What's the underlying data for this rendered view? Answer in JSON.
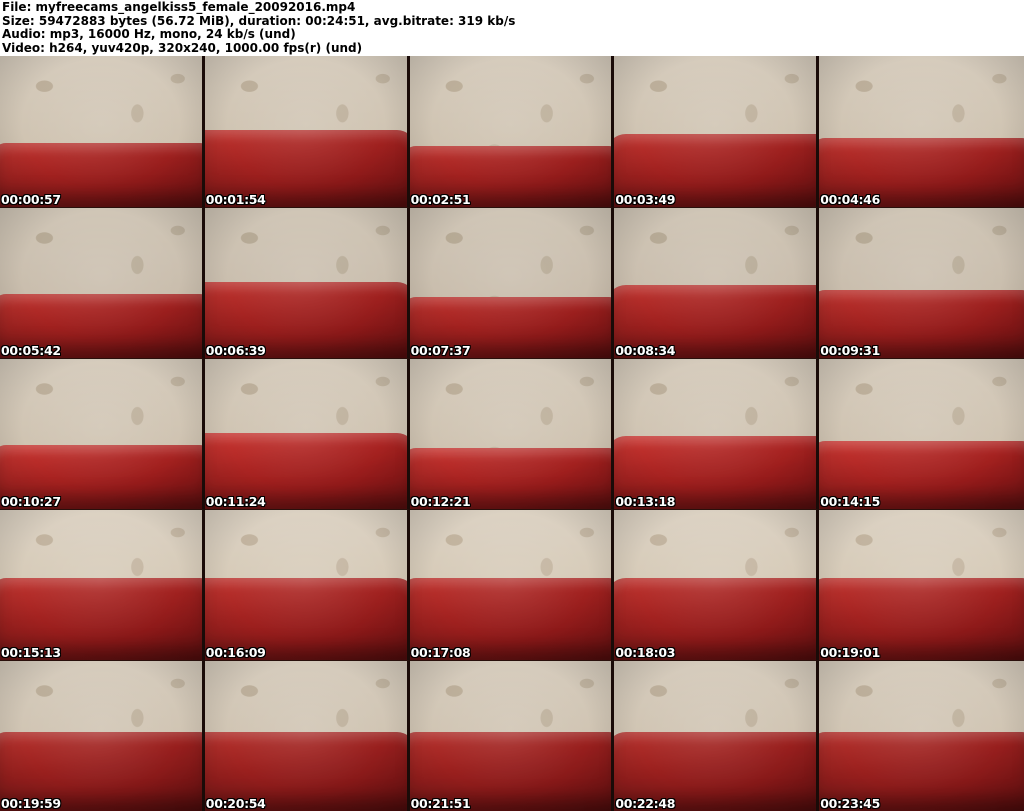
{
  "header": {
    "lines": [
      "File: myfreecams_angelkiss5_female_20092016.mp4",
      "Size: 59472883 bytes (56.72 MiB), duration: 00:24:51, avg.bitrate: 319 kb/s",
      "Audio: mp3, 16000 Hz, mono, 24 kb/s (und)",
      "Video: h264, yuv420p, 320x240, 1000.00 fps(r) (und)"
    ]
  },
  "grid": {
    "rows": 5,
    "cols": 5,
    "thumbnails": [
      {
        "timestamp": "00:00:57"
      },
      {
        "timestamp": "00:01:54"
      },
      {
        "timestamp": "00:02:51"
      },
      {
        "timestamp": "00:03:49"
      },
      {
        "timestamp": "00:04:46"
      },
      {
        "timestamp": "00:05:42"
      },
      {
        "timestamp": "00:06:39"
      },
      {
        "timestamp": "00:07:37"
      },
      {
        "timestamp": "00:08:34"
      },
      {
        "timestamp": "00:09:31"
      },
      {
        "timestamp": "00:10:27"
      },
      {
        "timestamp": "00:11:24"
      },
      {
        "timestamp": "00:12:21"
      },
      {
        "timestamp": "00:13:18"
      },
      {
        "timestamp": "00:14:15"
      },
      {
        "timestamp": "00:15:13"
      },
      {
        "timestamp": "00:16:09"
      },
      {
        "timestamp": "00:17:08"
      },
      {
        "timestamp": "00:18:03"
      },
      {
        "timestamp": "00:19:01"
      },
      {
        "timestamp": "00:19:59"
      },
      {
        "timestamp": "00:20:54"
      },
      {
        "timestamp": "00:21:51"
      },
      {
        "timestamp": "00:22:48"
      },
      {
        "timestamp": "00:23:45"
      }
    ]
  },
  "colors": {
    "header_bg": "#ffffff",
    "header_text": "#000000",
    "timestamp_text": "#ffffff",
    "timestamp_outline": "#000000",
    "wall_beige": "#cfc3b1",
    "couch_red": "#a32220",
    "separator_dark": "#1a0b08"
  }
}
